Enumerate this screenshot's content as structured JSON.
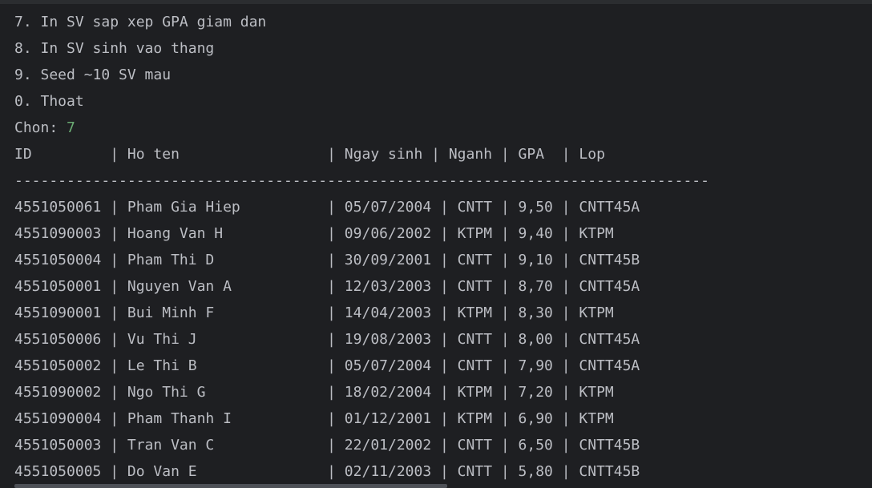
{
  "menu": [
    "7. In SV sap xep GPA giam dan",
    "8. In SV sinh vao thang",
    "9. Seed ~10 SV mau",
    "0. Thoat"
  ],
  "prompt": {
    "label": "Chon: ",
    "input": "7"
  },
  "table": {
    "header": "ID         | Ho ten                 | Ngay sinh | Nganh | GPA  | Lop",
    "separator": "--------------------------------------------------------------------------------",
    "rows": [
      "4551050061 | Pham Gia Hiep          | 05/07/2004 | CNTT | 9,50 | CNTT45A",
      "4551090003 | Hoang Van H            | 09/06/2002 | KTPM | 9,40 | KTPM",
      "4551050004 | Pham Thi D             | 30/09/2001 | CNTT | 9,10 | CNTT45B",
      "4551050001 | Nguyen Van A           | 12/03/2003 | CNTT | 8,70 | CNTT45A",
      "4551090001 | Bui Minh F             | 14/04/2003 | KTPM | 8,30 | KTPM",
      "4551050006 | Vu Thi J               | 19/08/2003 | CNTT | 8,00 | CNTT45A",
      "4551050002 | Le Thi B               | 05/07/2004 | CNTT | 7,90 | CNTT45A",
      "4551090002 | Ngo Thi G              | 18/02/2004 | KTPM | 7,20 | KTPM",
      "4551090004 | Pham Thanh I           | 01/12/2001 | KTPM | 6,90 | KTPM",
      "4551050003 | Tran Van C             | 22/01/2002 | CNTT | 6,50 | CNTT45B",
      "4551050005 | Do Van E               | 02/11/2003 | CNTT | 5,80 | CNTT45B"
    ]
  },
  "colors": {
    "background": "#1e1f22",
    "text": "#bcbec4",
    "user_input": "#6aab73"
  }
}
